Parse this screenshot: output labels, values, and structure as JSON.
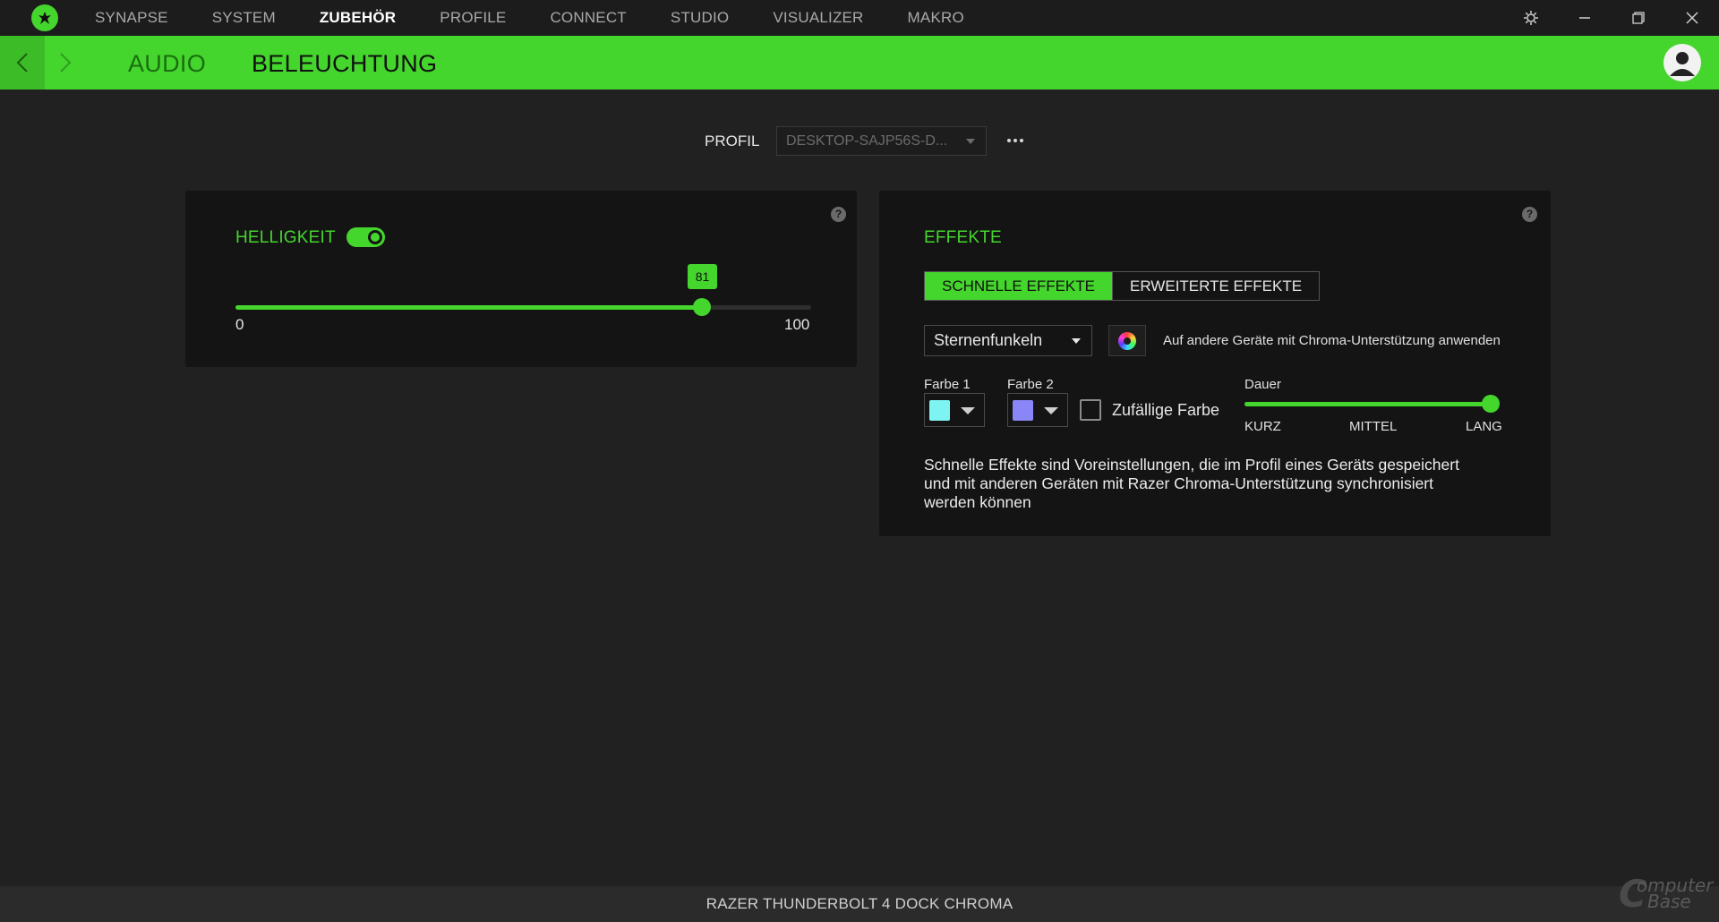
{
  "nav": {
    "items": [
      {
        "label": "SYNAPSE",
        "active": false
      },
      {
        "label": "SYSTEM",
        "active": false
      },
      {
        "label": "ZUBEHÖR",
        "active": true
      },
      {
        "label": "PROFILE",
        "active": false
      },
      {
        "label": "CONNECT",
        "active": false
      },
      {
        "label": "STUDIO",
        "active": false
      },
      {
        "label": "VISUALIZER",
        "active": false
      },
      {
        "label": "MAKRO",
        "active": false
      }
    ]
  },
  "subnav": {
    "tabs": [
      {
        "label": "AUDIO",
        "active": false
      },
      {
        "label": "BELEUCHTUNG",
        "active": true
      }
    ]
  },
  "profile": {
    "label": "PROFIL",
    "selected": "DESKTOP-SAJP56S-D..."
  },
  "brightness": {
    "title": "HELLIGKEIT",
    "enabled": true,
    "value": "81",
    "min": "0",
    "max": "100"
  },
  "effects": {
    "title": "EFFEKTE",
    "tab_quick": "SCHNELLE EFFEKTE",
    "tab_advanced": "ERWEITERTE EFFEKTE",
    "effect_selected": "Sternenfunkeln",
    "apply_text": "Auf andere Geräte mit Chroma-Unterstützung anwenden",
    "color1_label": "Farbe 1",
    "color1_value": "#7ef4f2",
    "color2_label": "Farbe 2",
    "color2_value": "#8a86f7",
    "random_label": "Zufällige Farbe",
    "random_checked": false,
    "duration_label": "Dauer",
    "duration_value": 1.0,
    "duration_short": "KURZ",
    "duration_mid": "MITTEL",
    "duration_long": "LANG",
    "description": "Schnelle Effekte sind Voreinstellungen, die im Profil eines Geräts gespeichert und mit anderen Geräten mit Razer Chroma-Unterstützung synchronisiert werden können"
  },
  "footer": {
    "device_name": "RAZER THUNDERBOLT 4 DOCK CHROMA"
  },
  "watermark": {
    "line1": "omputer",
    "line2": "Base"
  },
  "colors": {
    "accent": "#44d62c",
    "background": "#212121",
    "panel": "#141414"
  }
}
